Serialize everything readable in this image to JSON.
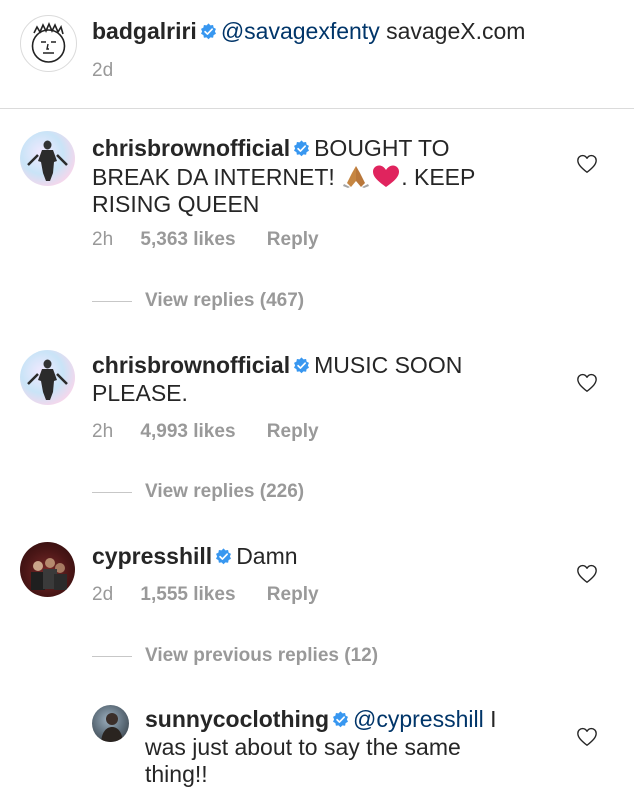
{
  "caption": {
    "username": "badgalriri",
    "mention": "@savagexfenty",
    "text": "savageX.com",
    "time": "2d"
  },
  "comments": [
    {
      "username": "chrisbrownofficial",
      "text_line1": "BOUGHT TO",
      "text_line2a": "BREAK DA INTERNET!",
      "text_line2b": ". KEEP",
      "text_line3": "RISING QUEEN",
      "emojis": [
        "folded-hands-emoji",
        "red-heart-emoji"
      ],
      "time": "2h",
      "likes": "5,363 likes",
      "reply": "Reply",
      "view_replies": "View replies (467)"
    },
    {
      "username": "chrisbrownofficial",
      "text_line1": "MUSIC SOON",
      "text_line2": "PLEASE.",
      "time": "2h",
      "likes": "4,993 likes",
      "reply": "Reply",
      "view_replies": "View replies (226)"
    },
    {
      "username": "cypresshill",
      "text_line1": "Damn",
      "time": "2d",
      "likes": "1,555 likes",
      "reply": "Reply",
      "view_replies": "View previous replies (12)"
    }
  ],
  "reply": {
    "username": "sunnycoclothing",
    "mention": "@cypresshill",
    "text_line1": "I",
    "text_line2": "was just about to say the same",
    "text_line3": "thing!!"
  },
  "colors": {
    "verified_blue": "#3897f0",
    "meta_gray": "#999999",
    "mention_blue": "#003569"
  }
}
